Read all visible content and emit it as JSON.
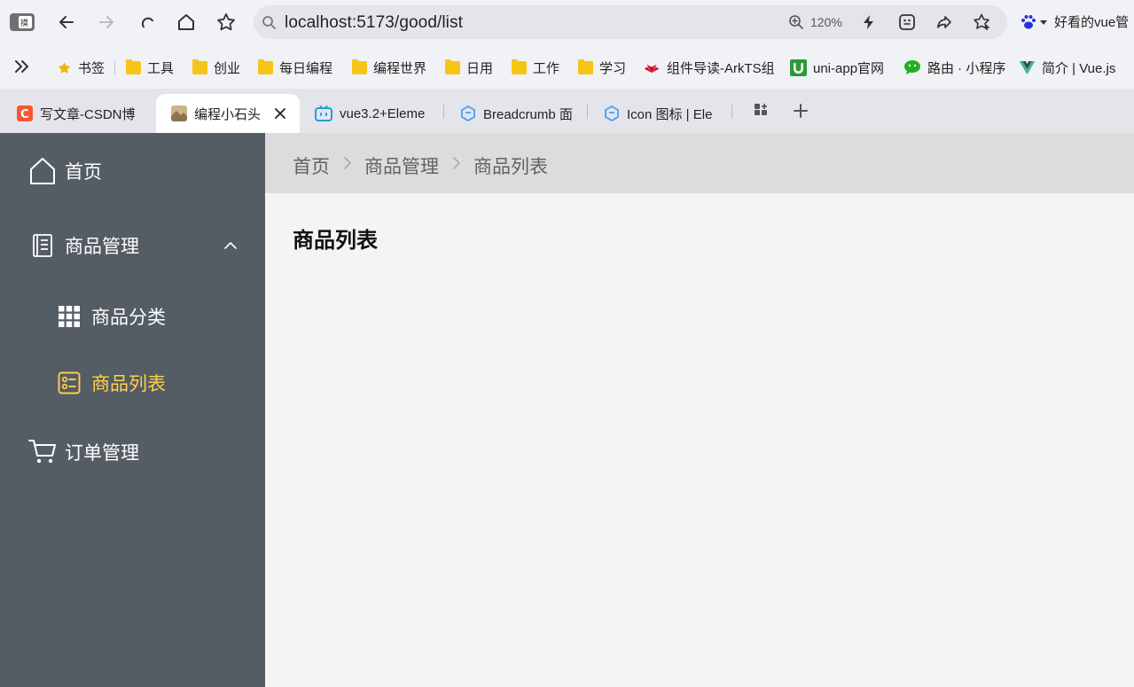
{
  "browser": {
    "address": "localhost:5173/good/list",
    "zoom": "120%",
    "profile_label": "好看的vue管",
    "icons": [
      "sidebar-icon",
      "back-icon",
      "forward-icon",
      "reload-icon",
      "home-icon",
      "star-icon",
      "search-icon",
      "zoom-icon",
      "bolt-icon",
      "extension-icon",
      "share-icon",
      "favorites-icon",
      "baidu-paw-icon",
      "chevron-down-icon"
    ]
  },
  "bookmarks": [
    {
      "label": "书签",
      "icon": "star-icon"
    },
    {
      "label": "工具",
      "icon": "folder-icon"
    },
    {
      "label": "创业",
      "icon": "folder-icon"
    },
    {
      "label": "每日编程",
      "icon": "folder-icon"
    },
    {
      "label": "编程世界",
      "icon": "folder-icon"
    },
    {
      "label": "日用",
      "icon": "folder-icon"
    },
    {
      "label": "工作",
      "icon": "folder-icon"
    },
    {
      "label": "学习",
      "icon": "folder-icon"
    },
    {
      "label": "组件导读-ArkTS组",
      "icon": "huawei-icon"
    },
    {
      "label": "uni-app官网",
      "icon": "uniapp-icon"
    },
    {
      "label": "路由 · 小程序",
      "icon": "wechat-icon"
    },
    {
      "label": "简介 | Vue.js",
      "icon": "vue-icon"
    }
  ],
  "tabs": [
    {
      "label": "写文章-CSDN博",
      "icon": "csdn-icon",
      "active": false
    },
    {
      "label": "编程小石头",
      "icon": "thumbnail-icon",
      "active": true
    },
    {
      "label": "vue3.2+Eleme",
      "icon": "bilibili-icon",
      "active": false
    },
    {
      "label": "Breadcrumb 面",
      "icon": "element-icon",
      "active": false
    },
    {
      "label": "Icon 图标 | Ele",
      "icon": "element-icon",
      "active": false
    }
  ],
  "sidebar": {
    "items": [
      {
        "label": "首页",
        "icon": "house-icon"
      },
      {
        "label": "商品管理",
        "icon": "document-icon",
        "expanded": true
      },
      {
        "label": "商品分类",
        "icon": "grid-icon"
      },
      {
        "label": "商品列表",
        "icon": "list-icon",
        "active": true
      },
      {
        "label": "订单管理",
        "icon": "shopping-cart-icon"
      }
    ]
  },
  "breadcrumb": [
    "首页",
    "商品管理",
    "商品列表"
  ],
  "page": {
    "title": "商品列表"
  },
  "colors": {
    "sidebar_bg": "#545c64",
    "active_text": "#ffd04b",
    "breadcrumb_bg": "#dcdcdc",
    "main_bg": "#f4f4f4"
  }
}
